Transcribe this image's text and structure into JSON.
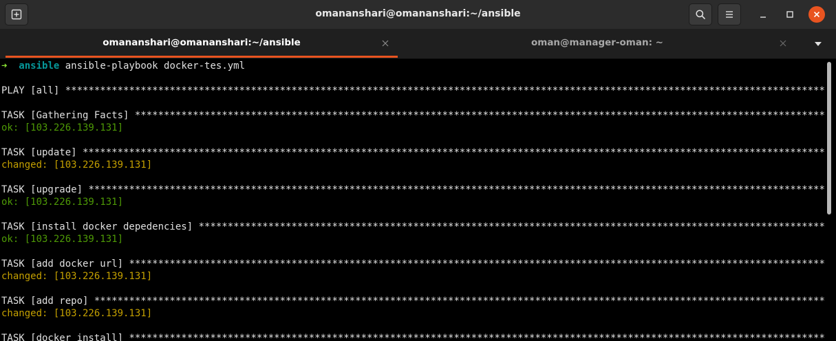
{
  "window": {
    "title": "omananshari@omananshari:~/ansible"
  },
  "header_buttons": {
    "new_tab_icon": "new-tab-icon",
    "search_icon": "search-icon",
    "menu_icon": "hamburger-menu-icon",
    "minimize_icon": "minimize-icon",
    "maximize_icon": "maximize-icon",
    "close_icon": "close-icon"
  },
  "tabs": [
    {
      "label": "omananshari@omananshari:~/ansible",
      "active": true
    },
    {
      "label": "oman@manager-oman: ~",
      "active": false
    }
  ],
  "colors": {
    "accent": "#e95420",
    "ok": "#4e9a06",
    "changed": "#c4a000",
    "prompt_dir": "#06989a",
    "prompt_arrow": "#8ae234"
  },
  "terminal": {
    "prompt": {
      "arrow": "➜",
      "dir": "ansible",
      "command": "ansible-playbook docker-tes.yml"
    },
    "lines": [
      {
        "header": "PLAY [all]"
      },
      {
        "header": "TASK [Gathering Facts]",
        "status": "ok: [103.226.139.131]",
        "kind": "ok"
      },
      {
        "header": "TASK [update]",
        "status": "changed: [103.226.139.131]",
        "kind": "changed"
      },
      {
        "header": "TASK [upgrade]",
        "status": "ok: [103.226.139.131]",
        "kind": "ok"
      },
      {
        "header": "TASK [install docker depedencies]",
        "status": "ok: [103.226.139.131]",
        "kind": "ok"
      },
      {
        "header": "TASK [add docker url]",
        "status": "changed: [103.226.139.131]",
        "kind": "changed"
      },
      {
        "header": "TASK [add repo]",
        "status": "changed: [103.226.139.131]",
        "kind": "changed"
      },
      {
        "header": "TASK [docker install]"
      }
    ]
  },
  "scrollbar": {
    "position_fraction": 0.0,
    "visible_fraction": 0.54
  }
}
